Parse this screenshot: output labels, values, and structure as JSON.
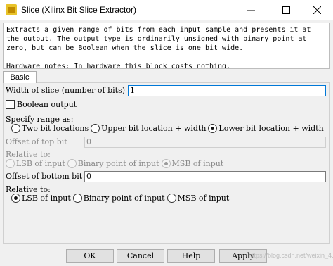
{
  "window": {
    "title": "Slice (Xilinx Bit Slice Extractor)",
    "controls": {
      "minimize_icon": "minimize-icon",
      "maximize_icon": "maximize-icon",
      "close_icon": "close-icon"
    }
  },
  "description": "Extracts a given range of bits from each input sample and presents it at the output. The output type is ordinarily unsigned with binary point at zero, but can be Boolean when the slice is one bit wide.\n\nHardware notes: In hardware this block costs nothing.",
  "tabs": [
    {
      "label": "Basic",
      "selected": true
    }
  ],
  "form": {
    "width_label": "Width of slice (number of bits)",
    "width_value": "1",
    "boolean_label": "Boolean output",
    "boolean_checked": false,
    "specify_label": "Specify range as:",
    "specify_options": [
      "Two bit locations",
      "Upper bit location + width",
      "Lower bit location + width"
    ],
    "specify_selected": 2,
    "offset_top_label": "Offset of top bit",
    "offset_top_value": "0",
    "relative_to_1_label": "Relative to:",
    "relative_options_1": [
      "LSB of input",
      "Binary point of input",
      "MSB of input"
    ],
    "relative_selected_1": 2,
    "offset_bottom_label": "Offset of bottom bit",
    "offset_bottom_value": "0",
    "relative_to_2_label": "Relative to:",
    "relative_options_2": [
      "LSB of input",
      "Binary point of input",
      "MSB of input"
    ],
    "relative_selected_2": 0
  },
  "buttons": {
    "ok": "OK",
    "cancel": "Cancel",
    "help": "Help",
    "apply": "Apply"
  },
  "watermark": "https://blog.csdn.net/weixin_4..."
}
